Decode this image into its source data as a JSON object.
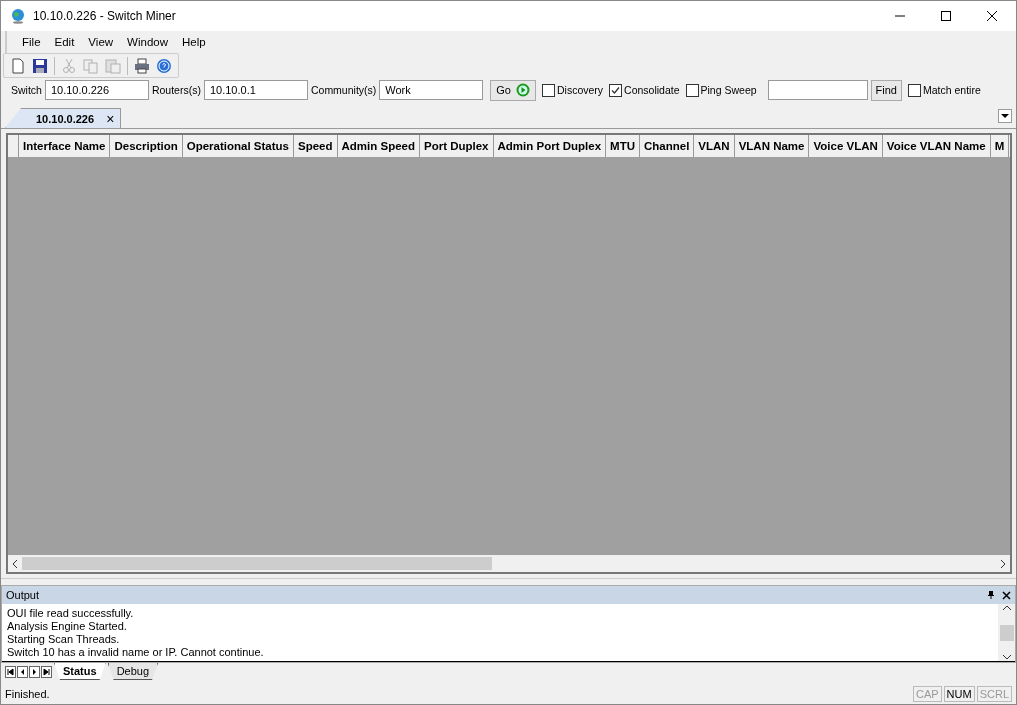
{
  "window": {
    "title": "10.10.0.226 - Switch Miner"
  },
  "menu": [
    "File",
    "Edit",
    "View",
    "Window",
    "Help"
  ],
  "toolbar": [
    {
      "kind": "new",
      "disabled": false
    },
    {
      "kind": "save",
      "disabled": false
    },
    {
      "kind": "sep"
    },
    {
      "kind": "cut",
      "disabled": true
    },
    {
      "kind": "copy",
      "disabled": true
    },
    {
      "kind": "paste",
      "disabled": true
    },
    {
      "kind": "sep"
    },
    {
      "kind": "print",
      "disabled": false
    },
    {
      "kind": "help",
      "disabled": false
    }
  ],
  "form": {
    "switch_label": "Switch",
    "switch_value": "10.10.0.226",
    "routers_label": "Routers(s)",
    "routers_value": "10.10.0.1",
    "community_label": "Community(s)",
    "community_value": "Work",
    "go": "Go",
    "options": [
      {
        "label": "Discovery",
        "checked": false
      },
      {
        "label": "Consolidate",
        "checked": true
      },
      {
        "label": "Ping Sweep",
        "checked": false
      }
    ],
    "find": "Find",
    "match": {
      "label": "Match entire",
      "checked": false
    }
  },
  "tabs": [
    {
      "label": "10.10.0.226",
      "close": "×",
      "selected": true
    }
  ],
  "table": {
    "columns": [
      "Interface Name",
      "Description",
      "Operational Status",
      "Speed",
      "Admin Speed",
      "Port Duplex",
      "Admin Port Duplex",
      "MTU",
      "Channel",
      "VLAN",
      "VLAN Name",
      "Voice VLAN",
      "Voice VLAN Name",
      "M"
    ]
  },
  "output": {
    "title": "Output",
    "lines": [
      "OUI file read successfully.",
      "Analysis Engine Started.",
      "Starting Scan Threads.",
      "Switch 10 has a invalid name or IP. Cannot continue."
    ],
    "tabs": [
      {
        "label": "Status",
        "selected": true
      },
      {
        "label": "Debug",
        "selected": false
      }
    ]
  },
  "status_bar": {
    "text": "Finished.",
    "indicators": [
      {
        "label": "CAP",
        "on": false
      },
      {
        "label": "NUM",
        "on": true
      },
      {
        "label": "SCRL",
        "on": false
      }
    ]
  }
}
